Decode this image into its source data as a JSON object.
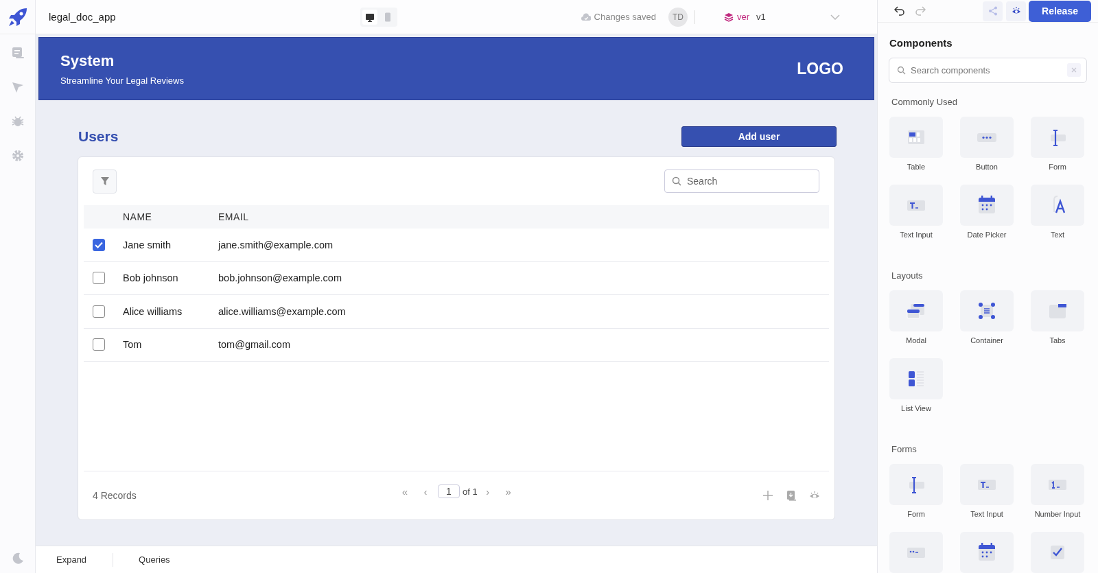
{
  "app": {
    "name": "legal_doc_app"
  },
  "topbar": {
    "device_modes": [
      {
        "kind": "desktop",
        "selected": true
      },
      {
        "kind": "mobile",
        "selected": false
      }
    ],
    "save_status": "Changes saved",
    "avatar": "TD",
    "version_label": "ver",
    "version": "v1",
    "release_button": "Release"
  },
  "header": {
    "title": "System",
    "subtitle": "Streamline Your Legal Reviews",
    "logo": "LOGO"
  },
  "users": {
    "title": "Users",
    "add_button": "Add user",
    "search": {
      "placeholder": "Search"
    },
    "columns": [
      "NAME",
      "EMAIL"
    ],
    "rows": [
      {
        "name": "Jane smith",
        "email": "jane.smith@example.com",
        "checked": true
      },
      {
        "name": "Bob johnson",
        "email": "bob.johnson@example.com",
        "checked": false
      },
      {
        "name": "Alice williams",
        "email": "alice.williams@example.com",
        "checked": false
      },
      {
        "name": "Tom",
        "email": "tom@gmail.com",
        "checked": false
      }
    ],
    "records": "4 Records",
    "pagination": {
      "first": "«",
      "prev": "‹",
      "page": "1",
      "of": "of 1",
      "next": "›",
      "last": "»"
    }
  },
  "bottom_bar": {
    "tabs": [
      "Expand",
      "Queries"
    ]
  },
  "components_panel": {
    "title": "Components",
    "search": {
      "placeholder": "Search components"
    },
    "sections": [
      {
        "title": "Commonly Used",
        "items": [
          {
            "kind": "table",
            "label": "Table"
          },
          {
            "kind": "button",
            "label": "Button"
          },
          {
            "kind": "form",
            "label": "Form"
          },
          {
            "kind": "text_input",
            "label": "Text Input"
          },
          {
            "kind": "date_picker",
            "label": "Date Picker"
          },
          {
            "kind": "text",
            "label": "Text"
          }
        ]
      },
      {
        "title": "Layouts",
        "items": [
          {
            "kind": "modal",
            "label": "Modal"
          },
          {
            "kind": "container",
            "label": "Container"
          },
          {
            "kind": "tabs",
            "label": "Tabs"
          },
          {
            "kind": "list_view",
            "label": "List View"
          }
        ]
      },
      {
        "title": "Forms",
        "items": [
          {
            "kind": "form",
            "label": "Form"
          },
          {
            "kind": "text_input",
            "label": "Text Input"
          },
          {
            "kind": "number_input",
            "label": "Number Input"
          },
          {
            "kind": "select"
          },
          {
            "kind": "date_picker"
          },
          {
            "kind": "checkbox"
          }
        ]
      }
    ]
  }
}
